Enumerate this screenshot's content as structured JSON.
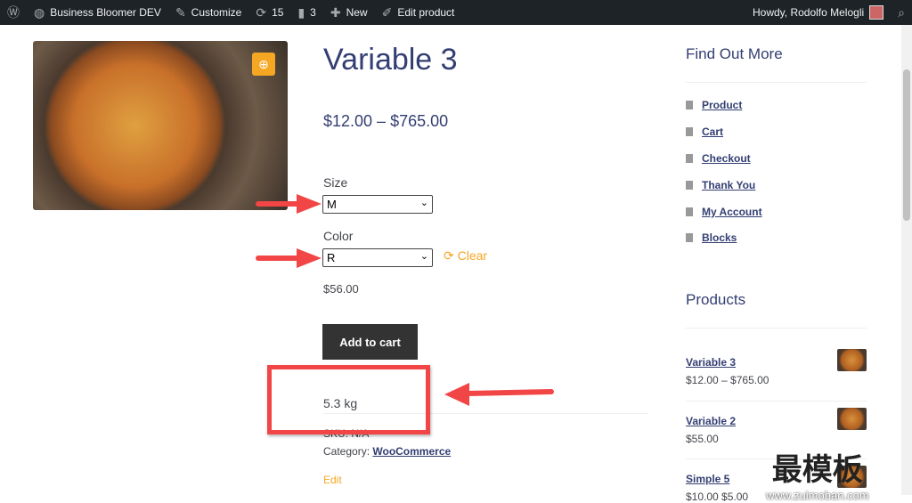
{
  "adminbar": {
    "site": "Business Bloomer DEV",
    "customize": "Customize",
    "updates": "15",
    "comments": "3",
    "new": "New",
    "edit": "Edit product",
    "howdy": "Howdy, Rodolfo Melogli"
  },
  "product": {
    "title": "Variable 3",
    "price": "$12.00 – $765.00",
    "size_label": "Size",
    "size_value": "M",
    "color_label": "Color",
    "color_value": "R",
    "clear": "Clear",
    "variation_price": "$56.00",
    "add_to_cart": "Add to cart",
    "weight": "5.3 kg",
    "sku": "SKU: N/A",
    "category_label": "Category:",
    "category": "WooCommerce",
    "edit": "Edit"
  },
  "sidebar": {
    "find_title": "Find Out More",
    "links": [
      "Product",
      "Cart",
      "Checkout",
      "Thank You",
      "My Account",
      "Blocks"
    ],
    "products_title": "Products",
    "products": [
      {
        "name": "Variable 3",
        "price": "$12.00 – $765.00"
      },
      {
        "name": "Variable 2",
        "price": "$55.00"
      },
      {
        "name": "Simple 5",
        "price": "$10.00 $5.00"
      }
    ]
  },
  "watermark": {
    "cn": "最模板",
    "url": "www.zuimoban.com"
  },
  "colors": {
    "accent": "#f5a623",
    "annotation": "#f24646",
    "link": "#333e72"
  }
}
